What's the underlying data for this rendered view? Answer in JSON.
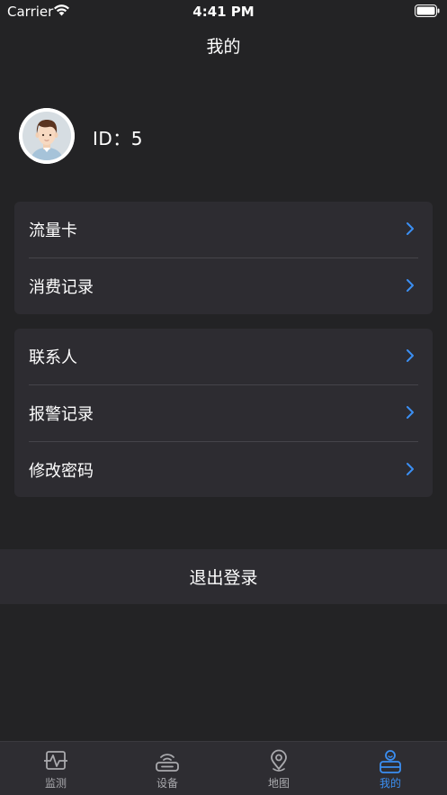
{
  "status_bar": {
    "carrier": "Carrier",
    "time": "4:41 PM"
  },
  "nav": {
    "title": "我的"
  },
  "profile": {
    "id_text": "ID：5"
  },
  "menu_group_1": [
    {
      "label": "流量卡"
    },
    {
      "label": "消费记录"
    }
  ],
  "menu_group_2": [
    {
      "label": "联系人"
    },
    {
      "label": "报警记录"
    },
    {
      "label": "修改密码"
    }
  ],
  "logout": {
    "label": "退出登录"
  },
  "tabs": [
    {
      "label": "监测",
      "icon": "monitor-icon",
      "active": false
    },
    {
      "label": "设备",
      "icon": "device-icon",
      "active": false
    },
    {
      "label": "地图",
      "icon": "map-pin-icon",
      "active": false
    },
    {
      "label": "我的",
      "icon": "user-icon",
      "active": true
    }
  ],
  "colors": {
    "background": "#232325",
    "card": "#2d2c31",
    "accent": "#3b8ff3"
  }
}
